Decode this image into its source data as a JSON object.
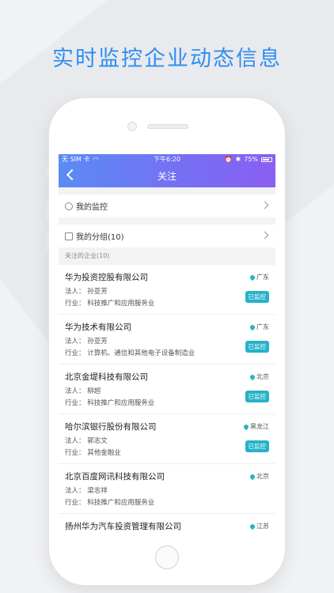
{
  "headline": "实时监控企业动态信息",
  "status_bar": {
    "carrier": "无 SIM 卡",
    "time": "下午6:20",
    "battery": "75%"
  },
  "nav": {
    "title": "关注"
  },
  "menu": [
    {
      "label": "我的监控",
      "icon": "monitor-icon"
    },
    {
      "label": "我的分组(10)",
      "icon": "group-icon"
    }
  ],
  "section_label": "关注的企业(10)",
  "accent_color": "#26b2c8",
  "companies": [
    {
      "name": "华为投资控股有限公司",
      "legal": "法人：  孙亚芳",
      "industry": "行业：  科技推广和应用服务业",
      "location": "广东",
      "badge": "已监控"
    },
    {
      "name": "华为技术有限公司",
      "legal": "法人：  孙亚芳",
      "industry": "行业：  计算机、通信和其他电子设备制造业",
      "location": "广东",
      "badge": "已监控"
    },
    {
      "name": "北京金堤科技有限公司",
      "legal": "法人：  柳超",
      "industry": "行业：  科技推广和应用服务业",
      "location": "北京",
      "badge": "已监控"
    },
    {
      "name": "哈尔滨银行股份有限公司",
      "legal": "法人：  郭志文",
      "industry": "行业：  其他金融业",
      "location": "黑龙江",
      "badge": "已监控"
    },
    {
      "name": "北京百度网讯科技有限公司",
      "legal": "法人：  梁志祥",
      "industry": "行业：  科技推广和应用服务业",
      "location": "北京",
      "badge": ""
    },
    {
      "name": "扬州华为汽车投资管理有限公司",
      "legal": "",
      "industry": "",
      "location": "江苏",
      "badge": ""
    }
  ]
}
